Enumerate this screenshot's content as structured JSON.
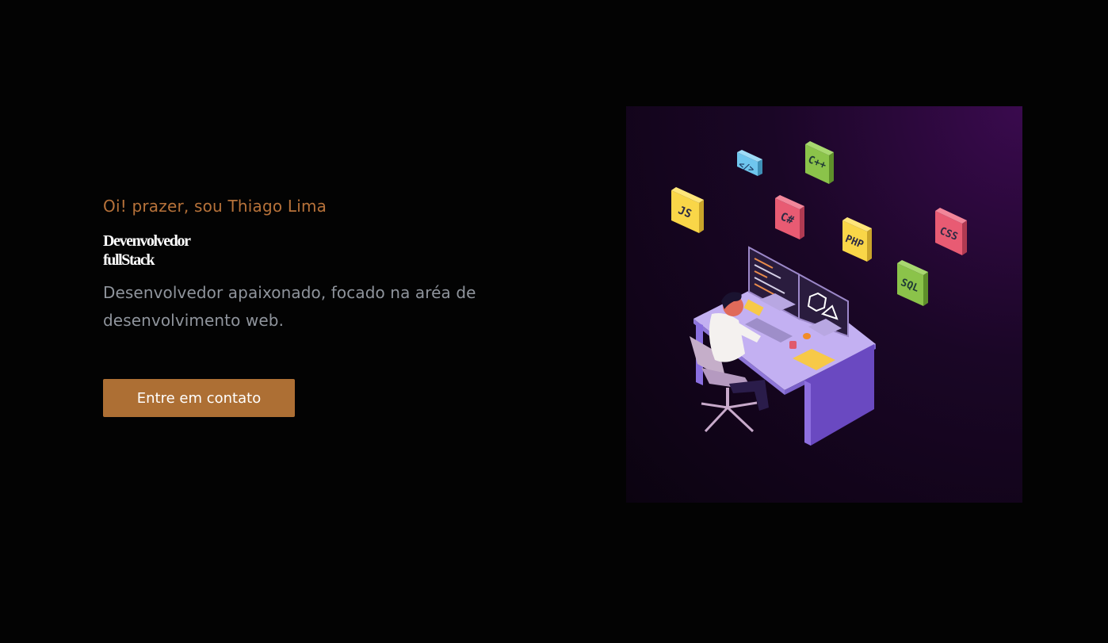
{
  "hero": {
    "greeting": "Oi! prazer, sou Thiago Lima",
    "headline_line1": "Devenvolvedor",
    "headline_line2": "fullStack",
    "description": "Desenvolvedor apaixonado, focado na aréa de desenvolvimento web.",
    "cta_label": "Entre em contato"
  },
  "illustration": {
    "tech_tags": [
      "</>",
      "C++",
      "JS",
      "C#",
      "PHP",
      "CSS",
      "SQL"
    ]
  },
  "colors": {
    "background": "#030303",
    "accent": "#ad6f34",
    "greeting": "#b7723a",
    "headline": "#ffffff",
    "description": "#8f949c"
  }
}
